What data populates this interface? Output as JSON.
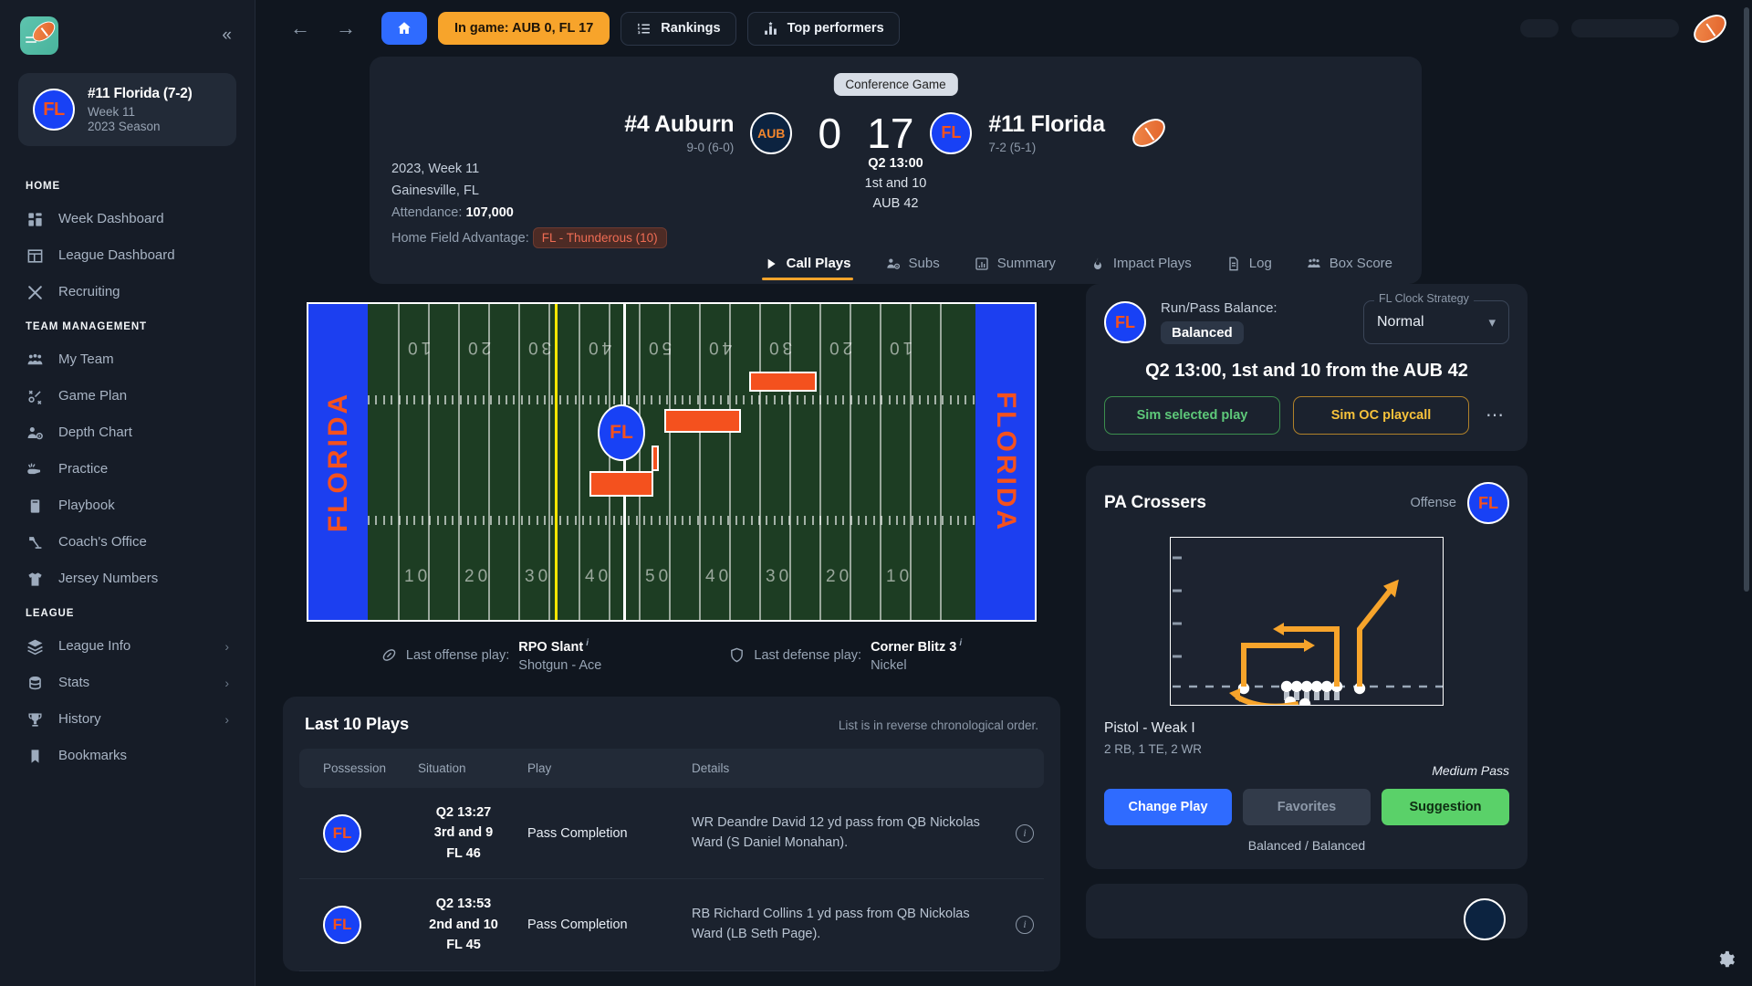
{
  "sidebar": {
    "collapse_icon": "chevrons-left-icon",
    "team_card": {
      "logo_text": "FL",
      "title": "#11 Florida (7-2)",
      "week": "Week 11",
      "season": "2023 Season"
    },
    "sections": [
      {
        "header": "HOME",
        "items": [
          {
            "label": "Week Dashboard",
            "icon": "dashboard-icon",
            "chevron": ""
          },
          {
            "label": "League Dashboard",
            "icon": "layout-icon",
            "chevron": ""
          },
          {
            "label": "Recruiting",
            "icon": "crossed-whistle-icon",
            "chevron": ""
          }
        ]
      },
      {
        "header": "TEAM MANAGEMENT",
        "items": [
          {
            "label": "My Team",
            "icon": "users-icon",
            "chevron": ""
          },
          {
            "label": "Game Plan",
            "icon": "strategy-icon",
            "chevron": ""
          },
          {
            "label": "Depth Chart",
            "icon": "user-cog-icon",
            "chevron": ""
          },
          {
            "label": "Practice",
            "icon": "whistle-icon",
            "chevron": ""
          },
          {
            "label": "Playbook",
            "icon": "book-icon",
            "chevron": ""
          },
          {
            "label": "Coach's Office",
            "icon": "desk-lamp-icon",
            "chevron": ""
          },
          {
            "label": "Jersey Numbers",
            "icon": "jersey-icon",
            "chevron": ""
          }
        ]
      },
      {
        "header": "LEAGUE",
        "items": [
          {
            "label": "League Info",
            "icon": "layers-icon",
            "chevron": "›"
          },
          {
            "label": "Stats",
            "icon": "database-icon",
            "chevron": "›"
          },
          {
            "label": "History",
            "icon": "trophy-icon",
            "chevron": "›"
          },
          {
            "label": "Bookmarks",
            "icon": "bookmark-icon",
            "chevron": ""
          }
        ]
      }
    ]
  },
  "topbar": {
    "back_icon": "arrow-left-icon",
    "forward_icon": "arrow-right-icon",
    "home_icon": "home-icon",
    "ingame_label": "In game: AUB 0, FL 17",
    "rankings_label": "Rankings",
    "rankings_icon": "ranked-list-icon",
    "top_performers_label": "Top performers",
    "top_performers_icon": "bar-chart-icon"
  },
  "scorebug": {
    "conference_chip": "Conference Game",
    "away": {
      "name": "#4 Auburn",
      "record": "9-0 (6-0)",
      "logo_text": "AUB",
      "score": "0"
    },
    "home": {
      "name": "#11 Florida",
      "record": "7-2 (5-1)",
      "logo_text": "FL",
      "score": "17"
    },
    "season_week": "2023, Week 11",
    "location": "Gainesville, FL",
    "attendance_label": "Attendance:",
    "attendance_value": "107,000",
    "hfa_label": "Home Field Advantage:",
    "hfa_value": "FL - Thunderous (10)",
    "clock": "Q2 13:00",
    "down_distance": "1st and 10",
    "field_position": "AUB 42",
    "tabs": [
      {
        "label": "Call Plays",
        "icon": "play-icon",
        "active": true
      },
      {
        "label": "Subs",
        "icon": "user-cog-icon",
        "active": false
      },
      {
        "label": "Summary",
        "icon": "bar-chart-icon",
        "active": false
      },
      {
        "label": "Impact Plays",
        "icon": "flame-icon",
        "active": false
      },
      {
        "label": "Log",
        "icon": "document-icon",
        "active": false
      },
      {
        "label": "Box Score",
        "icon": "users-icon",
        "active": false
      }
    ]
  },
  "field": {
    "endzone_left_text": "FLORIDA",
    "endzone_right_text": "FLORIDA",
    "ball_marker_text": "FL",
    "yard_numbers_top": [
      "10",
      "20",
      "30",
      "40",
      "50",
      "40",
      "30",
      "20",
      "10"
    ],
    "yard_numbers_bottom": [
      "10",
      "20",
      "30",
      "40",
      "50",
      "40",
      "30",
      "20",
      "10"
    ],
    "los_color": "#ffe600",
    "first_down_color": "#ffffff",
    "turf_color": "#1d3d23",
    "endzone_color": "#1c3ff0"
  },
  "last_plays": {
    "offense_label": "Last offense play:",
    "offense_play": "RPO Slant",
    "offense_formation": "Shotgun - Ace",
    "offense_icon": "football-icon",
    "defense_label": "Last defense play:",
    "defense_play": "Corner Blitz 3",
    "defense_formation": "Nickel",
    "defense_icon": "shield-icon"
  },
  "last_ten_plays": {
    "title": "Last 10 Plays",
    "note": "List is in reverse chronological order.",
    "columns": [
      "Possession",
      "Situation",
      "Play",
      "Details",
      ""
    ],
    "rows": [
      {
        "possession": "FL",
        "clock": "Q2 13:27",
        "down": "3rd and 9",
        "spot": "FL 46",
        "play": "Pass Completion",
        "details": "WR Deandre David 12 yd pass from QB Nickolas Ward (S Daniel Monahan).",
        "info_icon": "info-icon"
      },
      {
        "possession": "FL",
        "clock": "Q2 13:53",
        "down": "2nd and 10",
        "spot": "FL 45",
        "play": "Pass Completion",
        "details": "RB Richard Collins 1 yd pass from QB Nickolas Ward (LB Seth Page).",
        "info_icon": "info-icon"
      }
    ]
  },
  "playcall": {
    "team_logo": "FL",
    "run_pass_label": "Run/Pass Balance:",
    "run_pass_value": "Balanced",
    "clock_strategy_legend": "FL Clock Strategy",
    "clock_strategy_value": "Normal",
    "clock_strategy_icon": "chevron-down-icon",
    "situation": "Q2 13:00, 1st and 10 from the AUB 42",
    "sim_selected_label": "Sim selected play",
    "sim_oc_label": "Sim OC playcall",
    "more_icon": "ellipsis-icon"
  },
  "selected_play": {
    "name": "PA Crossers",
    "side_label": "Offense",
    "side_logo": "FL",
    "formation": "Pistol - Weak I",
    "personnel": "2 RB, 1 TE, 2 WR",
    "play_type": "Medium Pass",
    "buttons": {
      "change_play": "Change Play",
      "favorites": "Favorites",
      "suggestion": "Suggestion"
    },
    "footer": "Balanced / Balanced"
  },
  "colors": {
    "accent_orange": "#f7a42b",
    "accent_blue": "#2f6bff",
    "florida_blue": "#1841f5",
    "florida_orange": "#f4511e",
    "auburn_navy": "#0c2340",
    "green": "#5ad169",
    "bg": "#10161f",
    "panel": "#1b222e"
  },
  "settings_icon": "gear-icon"
}
